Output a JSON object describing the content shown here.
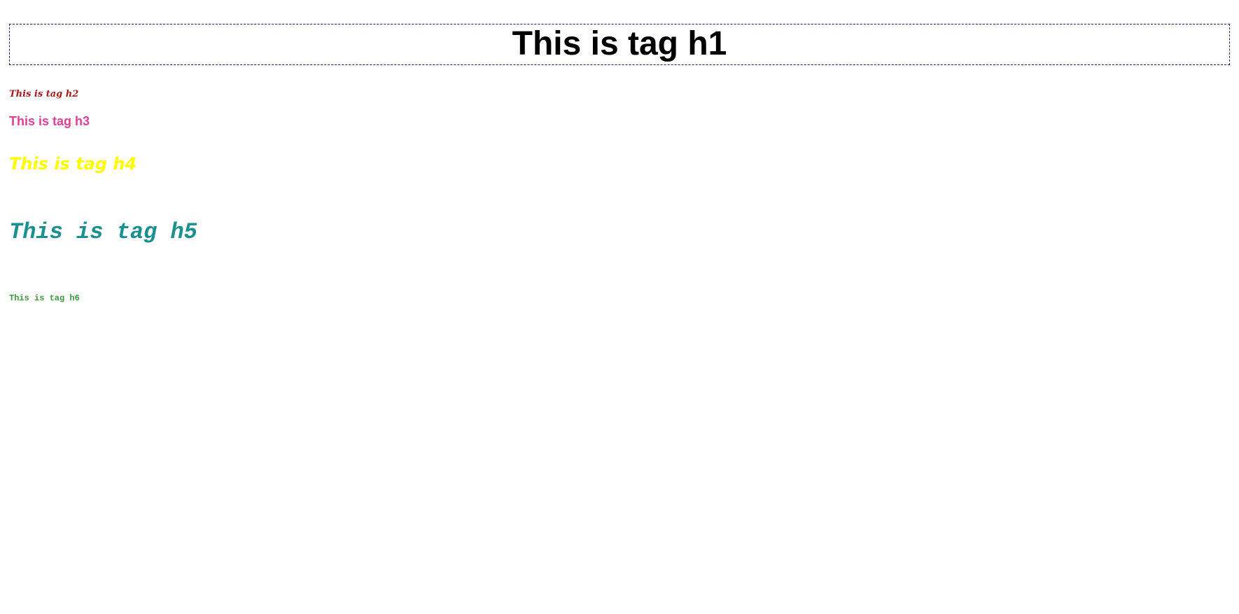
{
  "headings": {
    "h1": {
      "text": "This is tag h1",
      "color": "#000000"
    },
    "h2": {
      "text": "This is tag h2",
      "color": "#a51c1c"
    },
    "h3": {
      "text": "This is tag h3",
      "color": "#e0409a"
    },
    "h4": {
      "text": "This is tag h4",
      "color": "#ffff00"
    },
    "h5": {
      "text": "This is tag h5",
      "color": "#1a9090"
    },
    "h6": {
      "text": "This is tag h6",
      "color": "#3a9a3a"
    }
  },
  "h1_border_color": "#1a1a6e"
}
